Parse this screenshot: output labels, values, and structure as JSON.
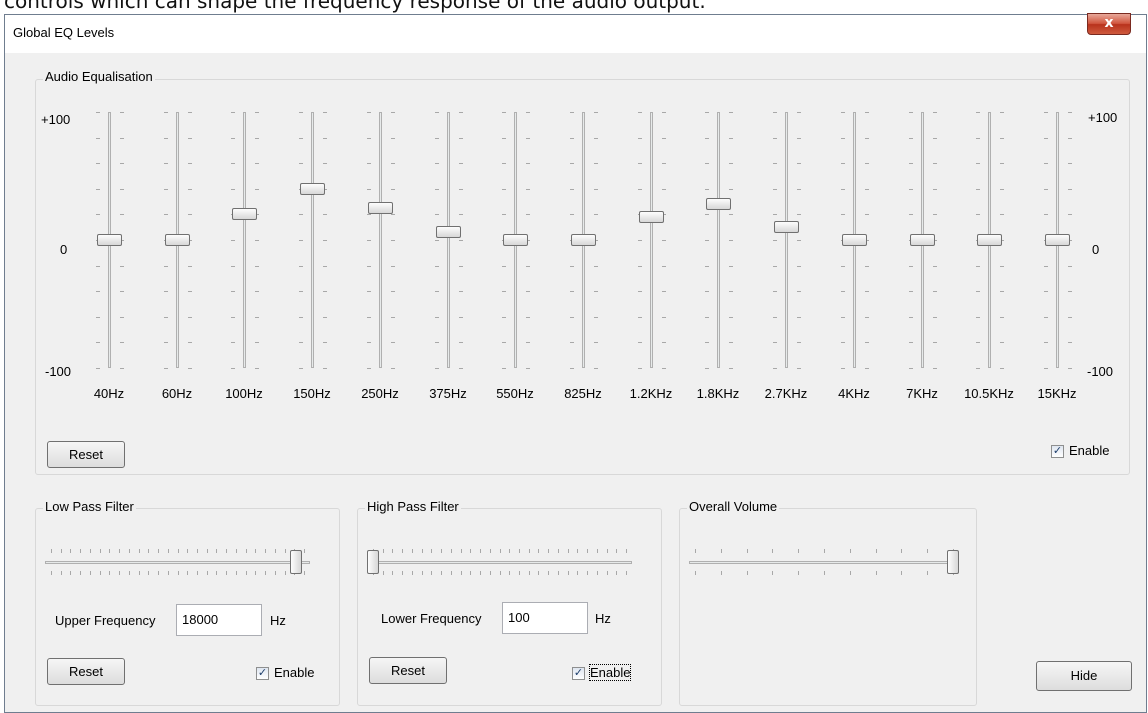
{
  "caption": "controls which can shape the frequency response of the audio output.",
  "window": {
    "title": "Global EQ Levels",
    "close_glyph": "x"
  },
  "eq": {
    "group_label": "Audio Equalisation",
    "scale": {
      "top": "+100",
      "middle": "0",
      "bottom": "-100"
    },
    "bands": [
      {
        "label": "40Hz",
        "value": 0
      },
      {
        "label": "60Hz",
        "value": 0
      },
      {
        "label": "100Hz",
        "value": 20
      },
      {
        "label": "150Hz",
        "value": 40
      },
      {
        "label": "250Hz",
        "value": 25
      },
      {
        "label": "375Hz",
        "value": 6
      },
      {
        "label": "550Hz",
        "value": 0
      },
      {
        "label": "825Hz",
        "value": 0
      },
      {
        "label": "1.2KHz",
        "value": 18
      },
      {
        "label": "1.8KHz",
        "value": 28
      },
      {
        "label": "2.7KHz",
        "value": 10
      },
      {
        "label": "4KHz",
        "value": 0
      },
      {
        "label": "7KHz",
        "value": 0
      },
      {
        "label": "10.5KHz",
        "value": 0
      },
      {
        "label": "15KHz",
        "value": 0
      }
    ],
    "reset_label": "Reset",
    "enable_label": "Enable",
    "enabled": true
  },
  "low_pass": {
    "group_label": "Low Pass Filter",
    "position": 0.97,
    "freq_label": "Upper Frequency",
    "freq_value": "18000",
    "unit": "Hz",
    "reset_label": "Reset",
    "enable_label": "Enable",
    "enabled": true
  },
  "high_pass": {
    "group_label": "High Pass Filter",
    "position": 0.0,
    "freq_label": "Lower Frequency",
    "freq_value": "100",
    "unit": "Hz",
    "reset_label": "Reset",
    "enable_label": "Enable",
    "enabled": true
  },
  "volume": {
    "group_label": "Overall Volume",
    "position": 1.0
  },
  "hide_label": "Hide",
  "check_glyph": "✓"
}
